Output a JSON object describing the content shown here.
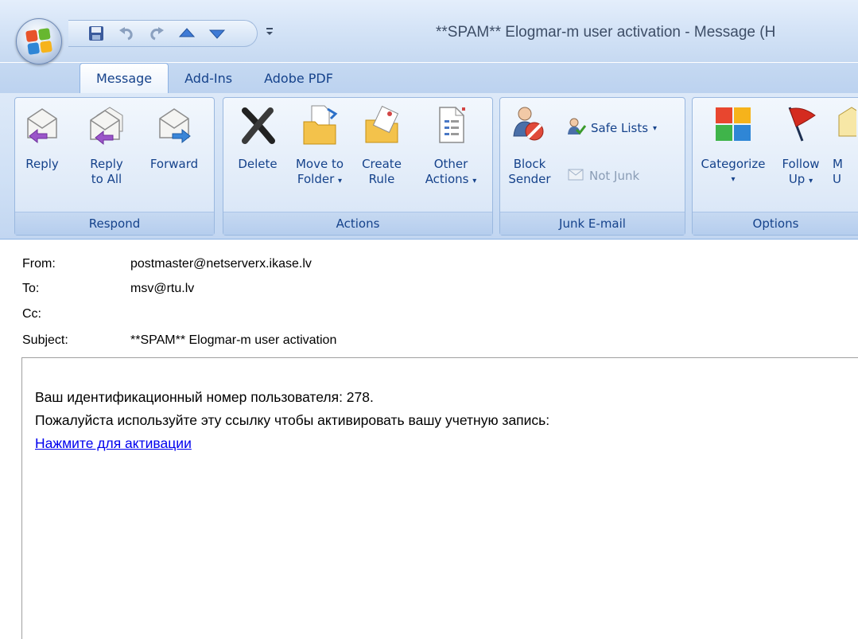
{
  "window": {
    "title": "**SPAM** Elogmar-m user activation - Message (H"
  },
  "quick_access": {
    "icons": [
      "save-icon",
      "undo-icon",
      "redo-icon",
      "previous-item-icon",
      "next-item-icon"
    ],
    "more": "▾"
  },
  "tabs": [
    {
      "label": "Message",
      "active": true
    },
    {
      "label": "Add-Ins",
      "active": false
    },
    {
      "label": "Adobe PDF",
      "active": false
    }
  ],
  "ribbon": {
    "respond": {
      "label": "Respond",
      "reply": "Reply",
      "reply_all_1": "Reply",
      "reply_all_2": "to All",
      "forward": "Forward"
    },
    "actions": {
      "label": "Actions",
      "delete": "Delete",
      "move_1": "Move to",
      "move_2": "Folder",
      "create_1": "Create",
      "create_2": "Rule",
      "other_1": "Other",
      "other_2": "Actions"
    },
    "junk": {
      "label": "Junk E-mail",
      "block_1": "Block",
      "block_2": "Sender",
      "safe_lists": "Safe Lists",
      "not_junk": "Not Junk"
    },
    "options": {
      "label": "Options",
      "categorize": "Categorize",
      "follow_1": "Follow",
      "follow_2": "Up",
      "mark_1": "M",
      "mark_2": "U"
    },
    "dropdown_glyph": "▾"
  },
  "header": {
    "from_label": "From:",
    "from_value": "postmaster@netserverx.ikase.lv",
    "to_label": "To:",
    "to_value": "msv@rtu.lv",
    "cc_label": "Cc:",
    "cc_value": "",
    "subject_label": "Subject:",
    "subject_value": "**SPAM** Elogmar-m user activation"
  },
  "body": {
    "line1": "Ваш идентификационный номер пользователя: 278.",
    "line2": "Пожалуйста используйте эту ссылку чтобы активировать вашу учетную запись:",
    "link": "Нажмите для активации"
  },
  "colors": {
    "ribbon_text": "#15428b",
    "link": "#0000ee"
  }
}
